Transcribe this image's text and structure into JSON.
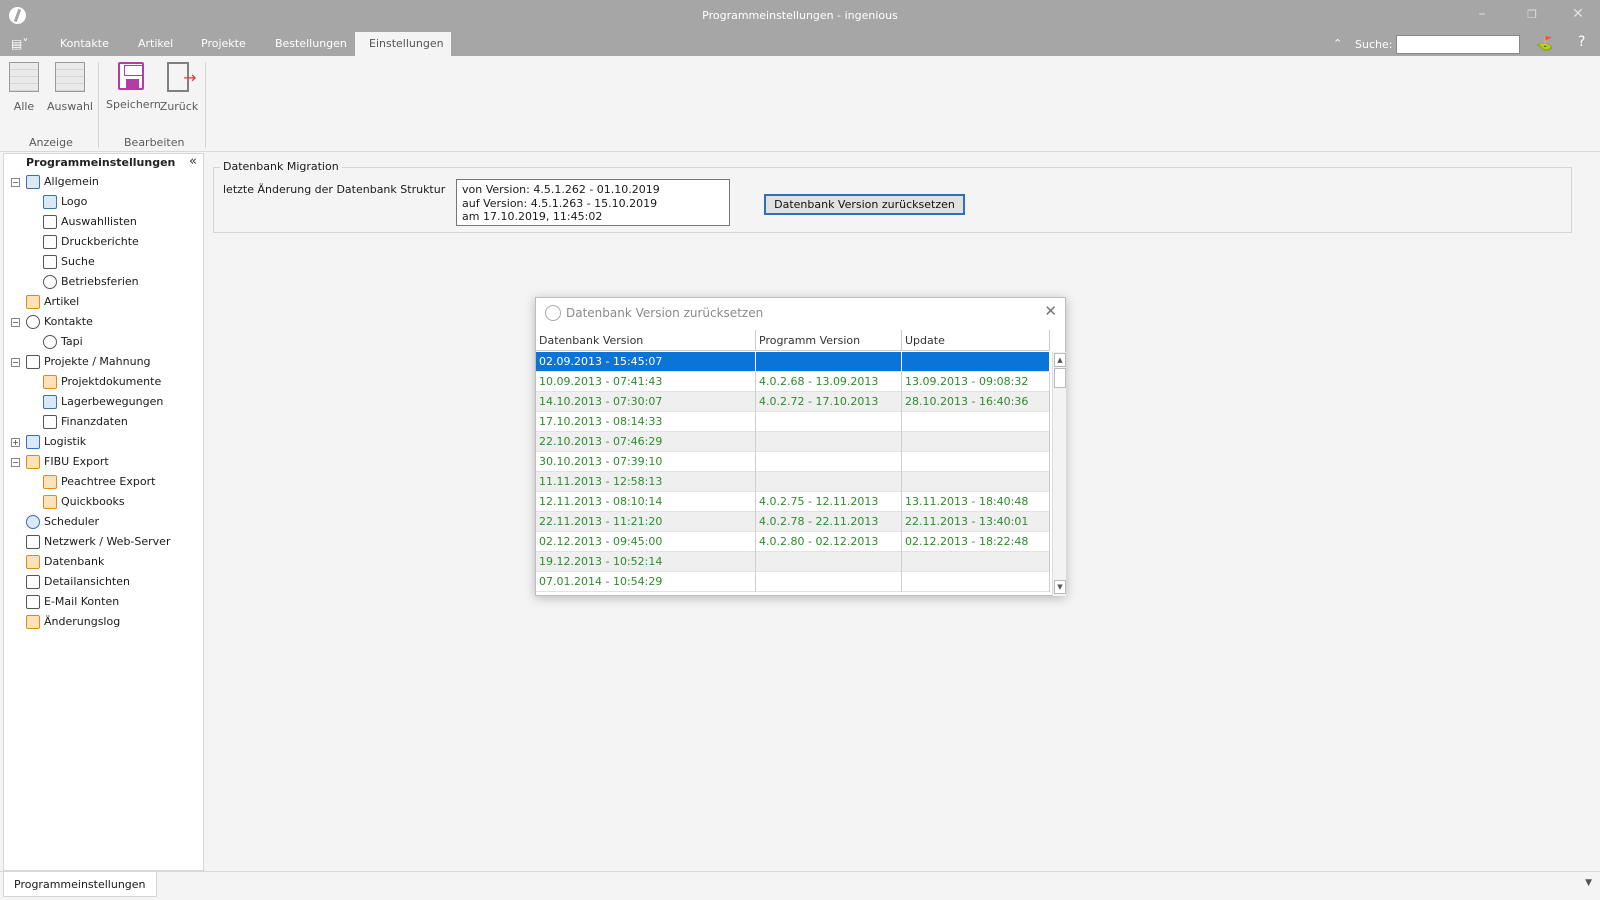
{
  "window": {
    "title": "Programmeinstellungen - ingenious"
  },
  "tabs": [
    "Kontakte",
    "Artikel",
    "Projekte",
    "Bestellungen",
    "Einstellungen"
  ],
  "search": {
    "label": "Suche:",
    "value": ""
  },
  "ribbon": {
    "buttons": {
      "all": "Alle",
      "selection": "Auswahl",
      "save": "Speichern",
      "back": "Zurück"
    },
    "groups": {
      "display": "Anzeige",
      "edit": "Bearbeiten"
    }
  },
  "panel": {
    "title": "Programmeinstellungen",
    "tree": [
      "Allgemein",
      "Logo",
      "Auswahllisten",
      "Druckberichte",
      "Suche",
      "Betriebsferien",
      "Artikel",
      "Kontakte",
      "Tapi",
      "Projekte / Mahnung",
      "Projektdokumente",
      "Lagerbewegungen",
      "Finanzdaten",
      "Logistik",
      "FIBU Export",
      "Peachtree Export",
      "Quickbooks",
      "Scheduler",
      "Netzwerk / Web-Server",
      "Datenbank",
      "Detailansichten",
      "E-Mail Konten",
      "Änderungslog"
    ]
  },
  "migration": {
    "group_title": "Datenbank Migration",
    "label": "letzte Änderung der Datenbank Struktur",
    "info": [
      "von Version: 4.5.1.262 - 01.10.2019",
      "auf Version: 4.5.1.263 - 15.10.2019",
      "am 17.10.2019, 11:45:02"
    ],
    "reset_button": "Datenbank Version zurücksetzen"
  },
  "dialog": {
    "title": "Datenbank Version zurücksetzen",
    "columns": [
      "Datenbank Version",
      "Programm Version",
      "Update"
    ],
    "rows": [
      [
        "02.09.2013 - 15:45:07",
        "",
        ""
      ],
      [
        "10.09.2013 - 07:41:43",
        "4.0.2.68 - 13.09.2013",
        "13.09.2013 - 09:08:32"
      ],
      [
        "14.10.2013 - 07:30:07",
        "4.0.2.72 - 17.10.2013",
        "28.10.2013 - 16:40:36"
      ],
      [
        "17.10.2013 - 08:14:33",
        "",
        ""
      ],
      [
        "22.10.2013 - 07:46:29",
        "",
        ""
      ],
      [
        "30.10.2013 - 07:39:10",
        "",
        ""
      ],
      [
        "11.11.2013 - 12:58:13",
        "",
        ""
      ],
      [
        "12.11.2013 - 08:10:14",
        "4.0.2.75 - 12.11.2013",
        "13.11.2013 - 18:40:48"
      ],
      [
        "22.11.2013 - 11:21:20",
        "4.0.2.78 - 22.11.2013",
        "22.11.2013 - 13:40:01"
      ],
      [
        "02.12.2013 - 09:45:00",
        "4.0.2.80 - 02.12.2013",
        "02.12.2013 - 18:22:48"
      ],
      [
        "19.12.2013 - 10:52:14",
        "",
        ""
      ],
      [
        "07.01.2014 - 10:54:29",
        "",
        ""
      ]
    ]
  },
  "bottom": {
    "tab": "Programmeinstellungen"
  },
  "colors": {
    "titlebar": "#a6a6a6",
    "selection": "#0a74d8",
    "data_text": "#2e8b2e",
    "accent_button": "#2f6fb7"
  }
}
